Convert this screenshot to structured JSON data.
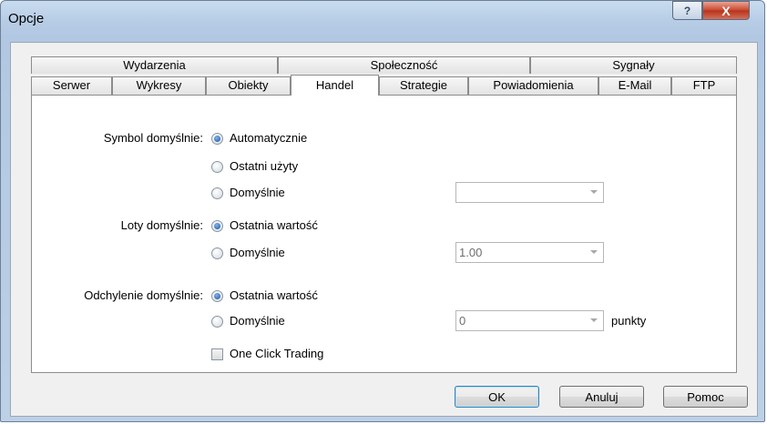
{
  "window": {
    "title": "Opcje",
    "help_glyph": "?",
    "close_glyph": "X"
  },
  "tabs_top": [
    "Wydarzenia",
    "Społeczność",
    "Sygnały"
  ],
  "tabs_bottom": [
    "Serwer",
    "Wykresy",
    "Obiekty",
    "Handel",
    "Strategie",
    "Powiadomienia",
    "E-Mail",
    "FTP"
  ],
  "active_tab": "Handel",
  "symbol": {
    "label": "Symbol domyślnie:",
    "options": [
      "Automatycznie",
      "Ostatni użyty",
      "Domyślnie"
    ],
    "selected": "Automatycznie",
    "combo_value": ""
  },
  "lots": {
    "label": "Loty domyślnie:",
    "options": [
      "Ostatnia wartość",
      "Domyślnie"
    ],
    "selected": "Ostatnia wartość",
    "combo_value": "1.00"
  },
  "deviation": {
    "label": "Odchylenie domyślnie:",
    "options": [
      "Ostatnia wartość",
      "Domyślnie"
    ],
    "selected": "Ostatnia wartość",
    "combo_value": "0",
    "unit": "punkty"
  },
  "one_click": {
    "label": "One Click Trading",
    "checked": false
  },
  "buttons": {
    "ok": "OK",
    "cancel": "Anuluj",
    "help": "Pomoc"
  }
}
